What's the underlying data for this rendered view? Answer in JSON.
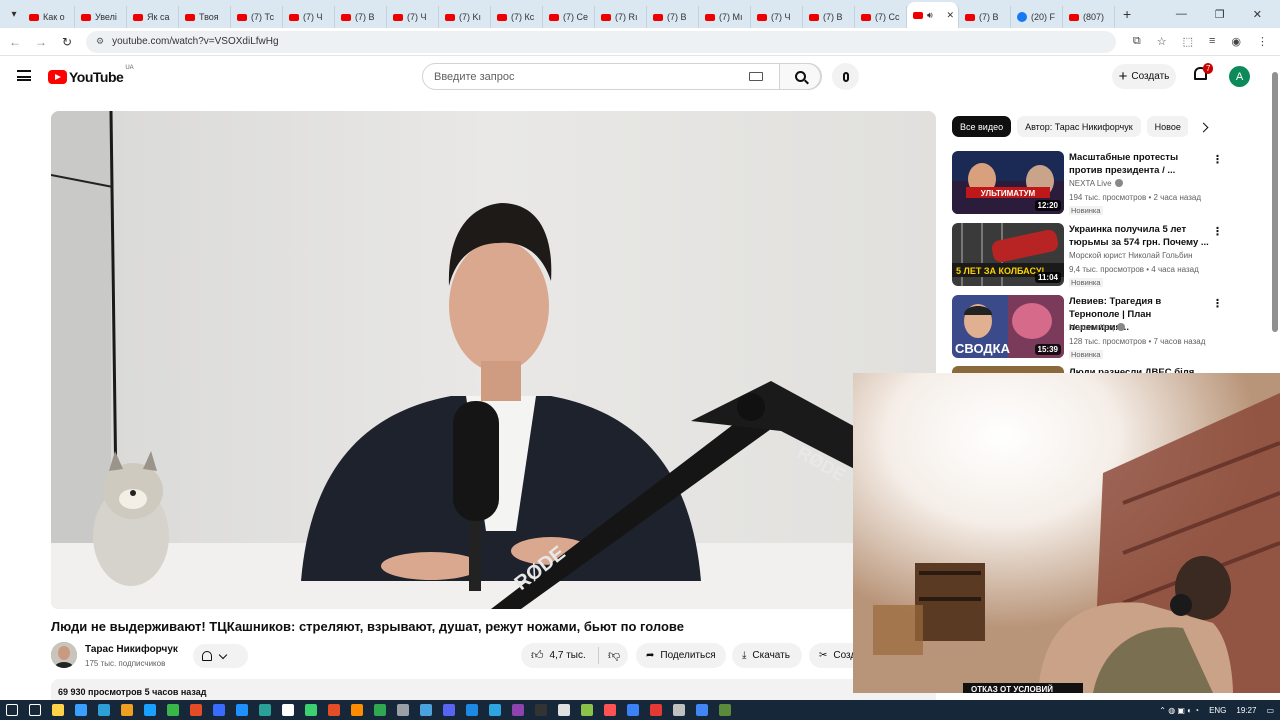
{
  "browser": {
    "tabs": [
      {
        "label": "Как о",
        "icon": "youtube-favicon"
      },
      {
        "label": "Увелі",
        "icon": "youtube-favicon"
      },
      {
        "label": "Як са",
        "icon": "youtube-favicon"
      },
      {
        "label": "Твоя",
        "icon": "youtube-favicon"
      },
      {
        "label": "(7) Тс",
        "icon": "youtube-favicon"
      },
      {
        "label": "(7) Ч",
        "icon": "youtube-favicon"
      },
      {
        "label": "(7) В",
        "icon": "youtube-favicon"
      },
      {
        "label": "(7) Ч",
        "icon": "youtube-favicon"
      },
      {
        "label": "(7) Kı",
        "icon": "youtube-favicon"
      },
      {
        "label": "(7) Кс",
        "icon": "youtube-favicon"
      },
      {
        "label": "(7) Се",
        "icon": "youtube-favicon"
      },
      {
        "label": "(7) Rı",
        "icon": "youtube-favicon"
      },
      {
        "label": "(7) В",
        "icon": "youtube-favicon"
      },
      {
        "label": "(7) Mı",
        "icon": "youtube-favicon"
      },
      {
        "label": "(7) Ч",
        "icon": "youtube-favicon"
      },
      {
        "label": "(7) В",
        "icon": "youtube-favicon"
      },
      {
        "label": "(7) Сс",
        "icon": "youtube-favicon"
      },
      {
        "label": "",
        "icon": "youtube-favicon",
        "active": true
      },
      {
        "label": "(7) В",
        "icon": "youtube-favicon"
      },
      {
        "label": "(20) F",
        "icon": "facebook-favicon"
      },
      {
        "label": "(807)",
        "icon": "youtube-favicon"
      }
    ],
    "url": "youtube.com/watch?v=VSOXdiLfwHg"
  },
  "header": {
    "logo_text": "YouTube",
    "country_code": "UA",
    "search_placeholder": "Введите запрос",
    "create_label": "Создать",
    "notifications_count": "7",
    "avatar_letter": "A"
  },
  "video": {
    "title": "Люди не выдерживают! ТЦКашников: стреляют, взрывают, душат, режут ножами, бьют по голове",
    "mic_brand_text": "RØDE",
    "channel_name": "Тарас Никифорчук",
    "subscribers": "175 тыс. подписчиков",
    "likes": "4,7 тыс.",
    "share_label": "Поделиться",
    "download_label": "Скачать",
    "clip_label": "Создать",
    "views_and_age": "69 930 просмотров  5 часов назад"
  },
  "sidebar": {
    "chips": [
      "Все видео",
      "Автор: Тарас Никифорчук",
      "Новое"
    ],
    "recommendations": [
      {
        "title": "Масштабные протесты против президента / ...",
        "channel": "NEXTA Live",
        "verified": true,
        "meta": "194 тыс. просмотров • 2 часа назад",
        "badge": "Новинка",
        "duration": "12:20",
        "thumb_caption": "УЛЬТИМАТУМ"
      },
      {
        "title": "Украинка получила 5 лет тюрьмы за 574 грн. Почему ...",
        "channel": "Морской юрист Николай Гольбин",
        "verified": false,
        "meta": "9,4 тыс. просмотров • 4 часа назад",
        "badge": "Новинка",
        "duration": "11:04",
        "thumb_caption": "5 ЛЕТ ЗА КОЛБАСУ!"
      },
      {
        "title": "Левиев: Трагедия в Тернополе | План перемирия...",
        "channel": "Максим Кац",
        "verified": true,
        "meta": "128 тыс. просмотров • 7 часов назад",
        "badge": "Новинка",
        "duration": "15:39",
        "thumb_caption": "СВОДКА"
      }
    ],
    "partial_title": "Люди разнесли ДВЕС біля..."
  },
  "webcam": {
    "caption": "ОТКАЗ ОТ УСЛОВИЙ"
  },
  "taskbar": {
    "language": "ENG",
    "time": "19:27"
  },
  "colors": {
    "youtube_red": "#ff0000",
    "chip_active": "#0f0f0f",
    "taskbar": "#16273a",
    "tabstrip": "#dbe8f2"
  }
}
